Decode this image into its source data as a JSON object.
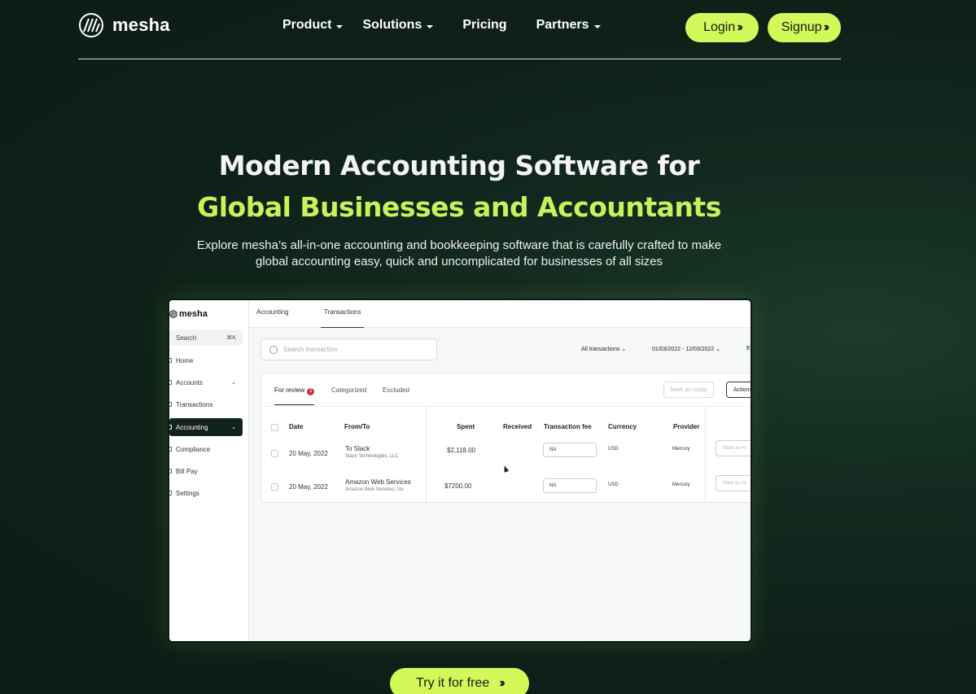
{
  "brand": {
    "name": "mesha",
    "logo_icon": "mesha-logo-icon"
  },
  "nav": {
    "items": [
      {
        "label": "Product",
        "has_dropdown": true
      },
      {
        "label": "Solutions",
        "has_dropdown": true
      },
      {
        "label": "Pricing",
        "has_dropdown": false
      },
      {
        "label": "Partners",
        "has_dropdown": true
      }
    ],
    "login_label": "Login",
    "signup_label": "Signup"
  },
  "hero": {
    "title_line1": "Modern Accounting Software for",
    "title_line2": "Global Businesses and Accountants",
    "subtitle_line1": "Explore mesha’s all-in-one accounting and bookkeeping software that is carefully crafted to make",
    "subtitle_line2": "global accounting easy, quick and uncomplicated for businesses of all sizes",
    "cta_label": "Try it for free"
  },
  "app": {
    "logo": "mesha",
    "search_label": "Search",
    "search_shortcut": "⌘K",
    "sidebar": [
      {
        "label": "Home"
      },
      {
        "label": "Accounts",
        "dropdown": "⌄"
      },
      {
        "label": "Transactions"
      },
      {
        "label": "Accounting",
        "dropdown": "⌄",
        "active": true
      },
      {
        "label": "Compliance"
      },
      {
        "label": "Bill Pay"
      },
      {
        "label": "Settings"
      }
    ],
    "top_tabs": [
      "Accounting",
      "Transactions"
    ],
    "search_placeholder": "Search transaction",
    "filter_all": "All transactions",
    "filter_date": "01/03/2022 - 12/03/2022",
    "filter_extra": "Ex",
    "tabs": {
      "review": "For review",
      "review_count": "2",
      "categorized": "Categorized",
      "excluded": "Excluded"
    },
    "mark_ready": "Mark as ready",
    "actions": "Actions",
    "columns": [
      "Date",
      "From/To",
      "Spent",
      "Received",
      "Transaction fee",
      "Currency",
      "Provider"
    ],
    "rows": [
      {
        "date": "20 May, 2022",
        "to": "To Slack",
        "to_sub": "Slack Technologies, LLC",
        "spent": "$2,118.00",
        "fee": "NA",
        "currency": "USD",
        "provider": "Mercury",
        "mark": "Mark as re"
      },
      {
        "date": "20 May, 2022",
        "to": "Amazon Web Services",
        "to_sub": "Amazon Web Services, Inc",
        "spent": "$7200.00",
        "fee": "NA",
        "currency": "USD",
        "provider": "Mercury",
        "mark": "Mark as re"
      }
    ]
  },
  "colors": {
    "accent": "#d3f85a",
    "background": "#0e2119",
    "highlight_text": "#c9f25a"
  }
}
